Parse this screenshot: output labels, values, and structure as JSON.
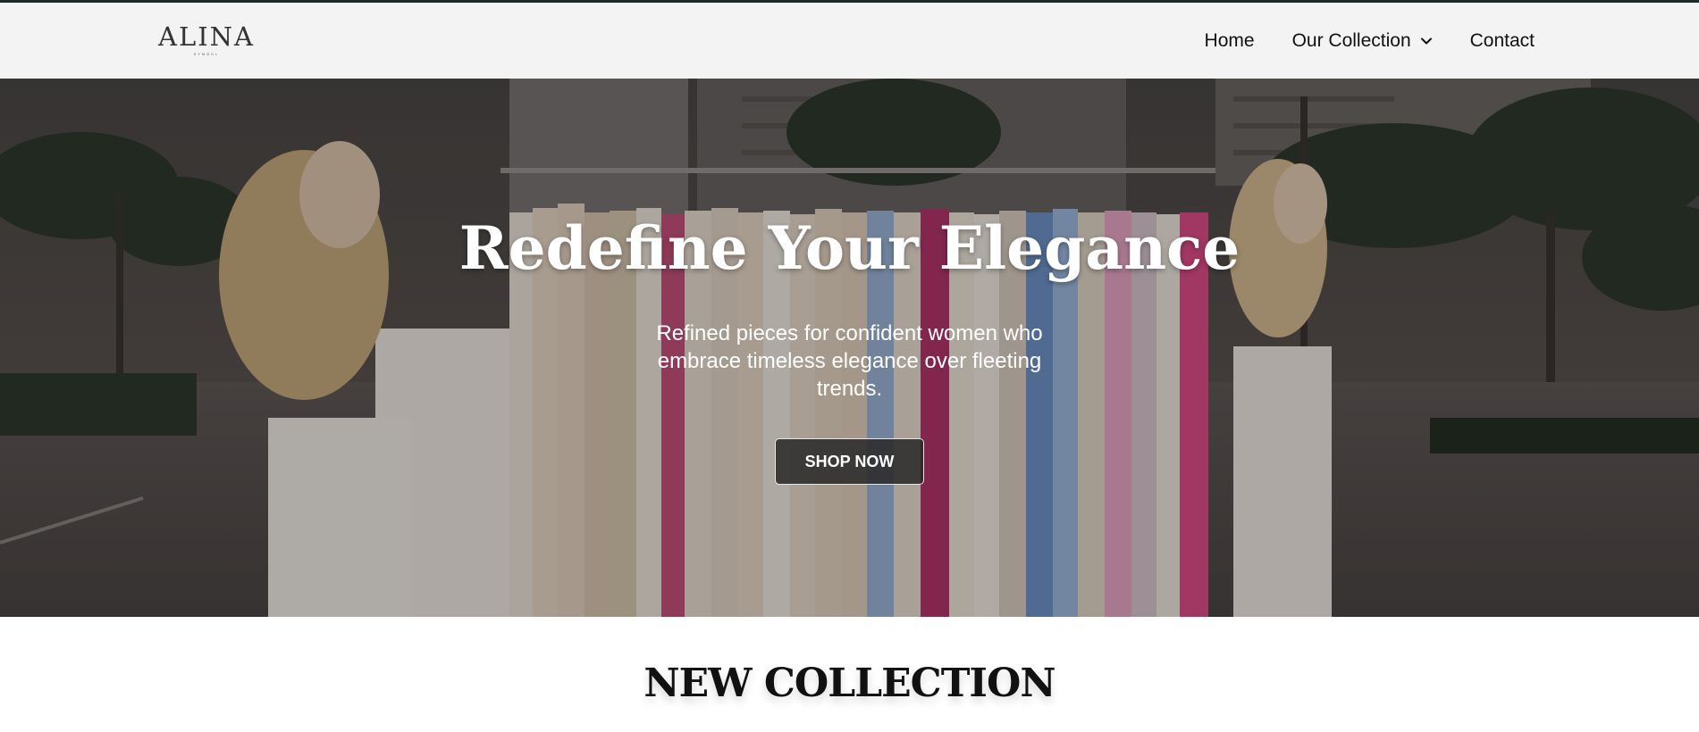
{
  "brand": {
    "logo_text": "ALINA",
    "logo_subtext": "SYMBOL",
    "accent_color": "#1d2a2c"
  },
  "nav": {
    "items": [
      {
        "label": "Home"
      },
      {
        "label": "Our Collection",
        "has_dropdown": true,
        "icon": "chevron-down-icon"
      },
      {
        "label": "Contact"
      }
    ]
  },
  "hero": {
    "title": "Redefine Your Elegance",
    "subtitle": "Refined pieces for confident women who embrace timeless elegance over fleeting trends.",
    "cta_label": "SHOP NOW",
    "image": "clothing-rack-women-street"
  },
  "section": {
    "title": "NEW COLLECTION"
  }
}
